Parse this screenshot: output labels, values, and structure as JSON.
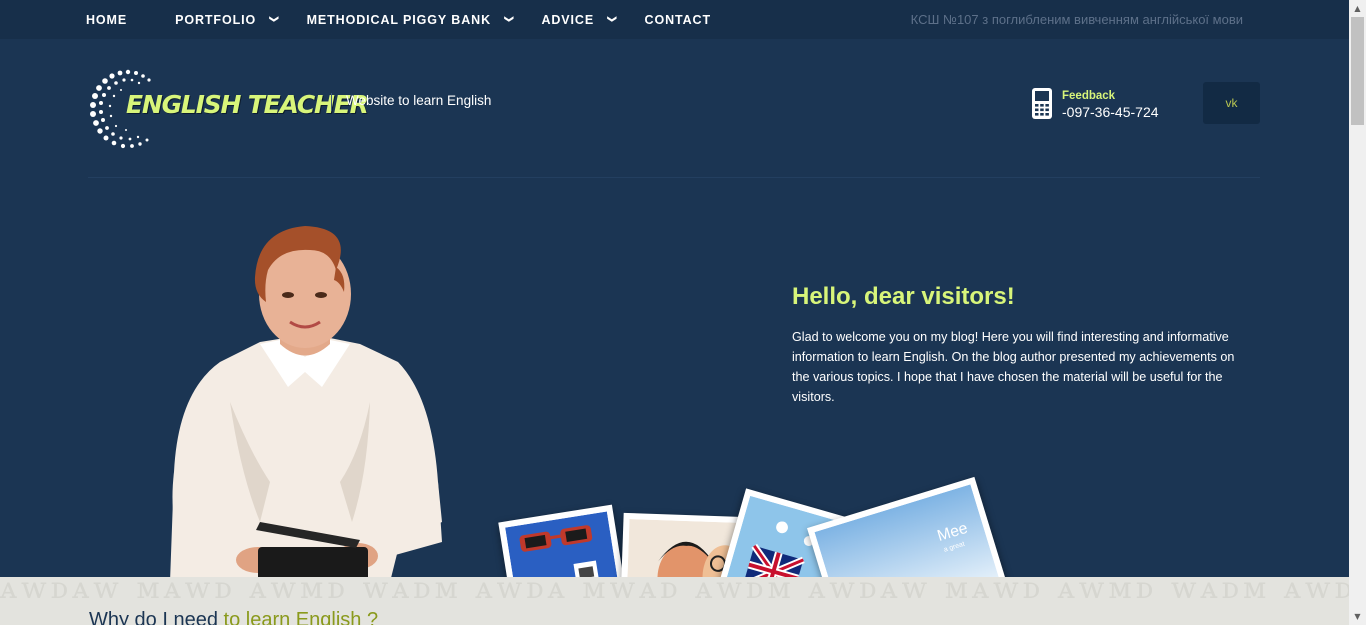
{
  "nav": {
    "home": "HOME",
    "portfolio": "PORTFOLIO",
    "piggy_bank": "METHODICAL PIGGY BANK",
    "advice": "ADVICE",
    "contact": "CONTACT",
    "dropdown_icon": "chevron-down-icon"
  },
  "school_name": "КСШ №107 з поглибленим вивченням англійської мови",
  "header": {
    "logo_text": "ENGLISH TEACHER",
    "tagline": "Website to learn English",
    "feedback_label": "Feedback",
    "phone": "-097-36-45-724",
    "vk_label": "vk"
  },
  "hero": {
    "title": "Hello, dear visitors!",
    "text": "Glad to welcome you on my blog! Here you will find interesting and informative information to learn English. On the blog author presented my achievements on the various topics. I hope that I have chosen the material will be useful for the visitors."
  },
  "photos": {
    "photo_4_caption": "Mee",
    "photo_4_sub": "a great"
  },
  "section": {
    "why_prefix": "Why do I need ",
    "why_accent": "to learn English ?"
  },
  "colors": {
    "background": "#1b3553",
    "topbar": "#172f4a",
    "accent_green": "#d8f57a",
    "olive": "#8a9a1c"
  }
}
